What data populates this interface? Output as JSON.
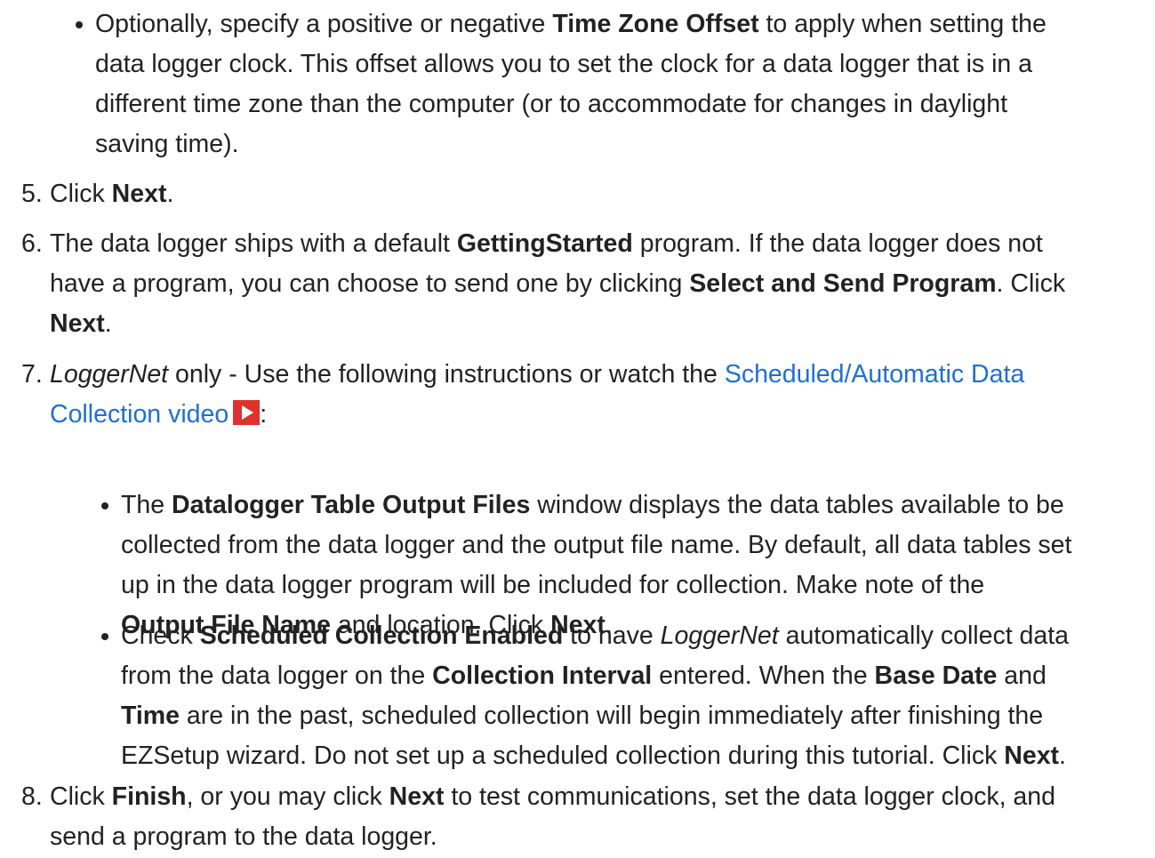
{
  "bullet_tz": {
    "t1": "Optionally, specify a positive or negative ",
    "b1": "Time Zone Offset",
    "t2": " to apply when setting the",
    "l2": "data logger clock. This offset allows you to set the clock for a data logger that is in a",
    "l3": "different time zone than the computer (or to accommodate for changes in daylight",
    "l4": "saving time)."
  },
  "step5": {
    "num": "5.",
    "t1": "Click ",
    "b1": "Next",
    "t2": "."
  },
  "step6": {
    "num": "6.",
    "t1": "The data logger ships with a default ",
    "b1": "GettingStarted",
    "t2": " program. If the data logger does not",
    "t3": "have a program, you can choose to send one by clicking ",
    "b2": "Select and Send Program",
    "t4": ". Click",
    "b3": "Next",
    "t5": "."
  },
  "step7": {
    "num": "7.",
    "i1": "LoggerNet",
    "t1": " only - Use the following instructions or watch the ",
    "link1": "Scheduled/Automatic Data",
    "link2": "Collection video",
    "t2": ":"
  },
  "bullet_tables": {
    "t1": "The ",
    "b1": "Datalogger Table Output Files",
    "t2": " window displays the data tables available to be",
    "l2": "collected from the data logger and the output file name. By default, all data tables set",
    "l3": "up in the data logger program will be included for collection. Make note of the",
    "b2": "Output File Name",
    "t3": " and location. Click ",
    "b3": "Next",
    "t4": "."
  },
  "bullet_sched": {
    "t1": "Check ",
    "b1": "Scheduled Collection Enabled",
    "t2": " to have ",
    "i1": "LoggerNet",
    "t3": " automatically collect data",
    "t4": "from the data logger on the ",
    "b2": "Collection Interval",
    "t5": " entered. When the ",
    "b3": "Base Date",
    "t6": " and",
    "b4": "Time",
    "t7": " are in the past, scheduled collection will begin immediately after finishing the",
    "t8": "EZSetup wizard. Do not set up a scheduled collection during this tutorial. Click ",
    "b5": "Next",
    "t9": "."
  },
  "step8": {
    "num": "8.",
    "t1": "Click ",
    "b1": "Finish",
    "t2": ", or you may click ",
    "b2": "Next",
    "t3": " to test communications, set the data logger clock, and",
    "l2": "send a program to the data logger."
  },
  "icons": {
    "video": "play-video-icon",
    "bullet": "bullet-dot-icon"
  },
  "colors": {
    "text": "#222222",
    "link": "#1f6fd1",
    "video_icon": "#e0312e"
  }
}
